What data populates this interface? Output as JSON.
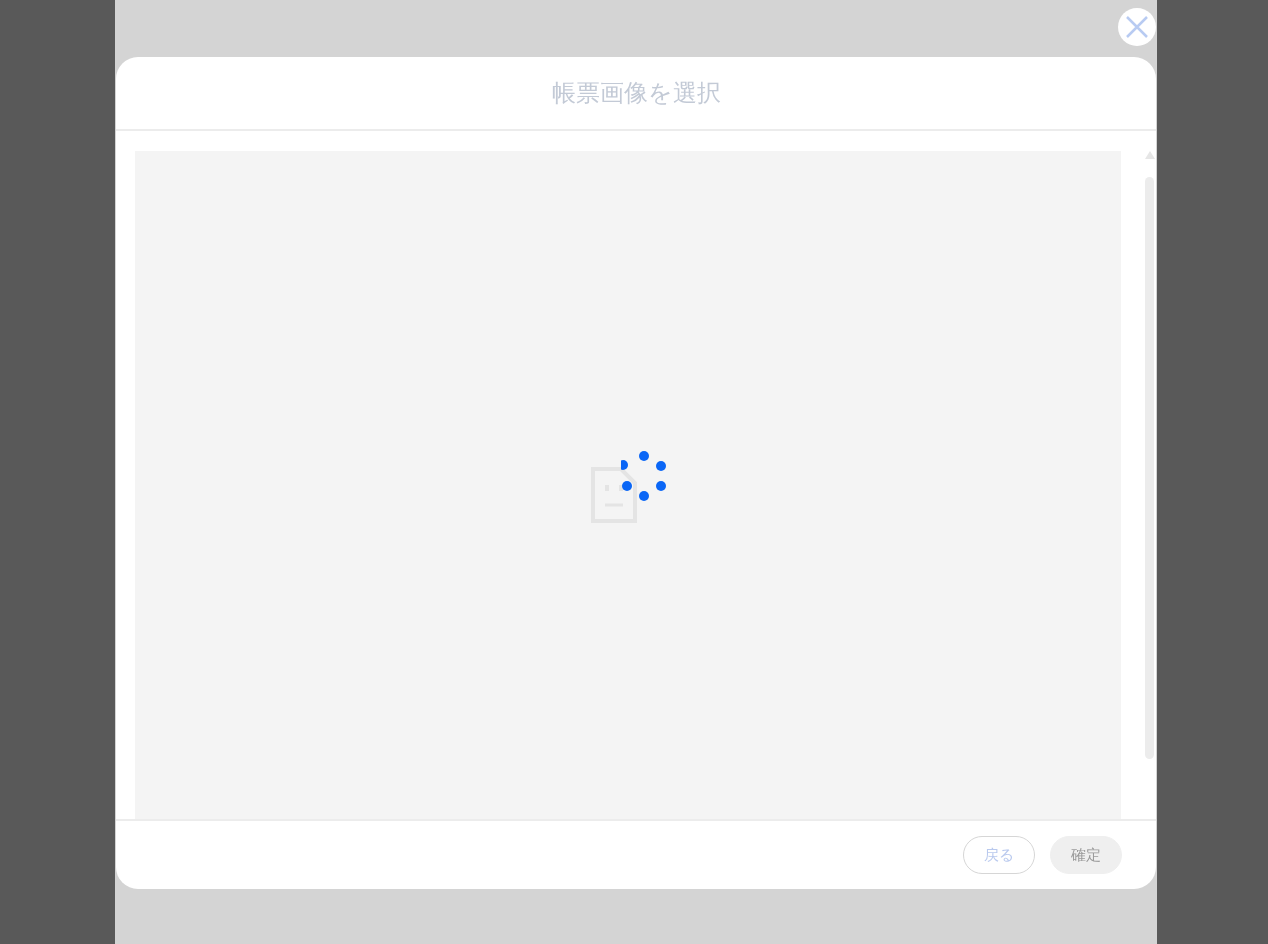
{
  "dialog": {
    "title": "帳票画像を選択",
    "loading": true,
    "buttons": [
      {
        "label": "戻る",
        "kind": "secondary"
      },
      {
        "label": "確定",
        "kind": "primary",
        "disabled": true
      }
    ]
  }
}
